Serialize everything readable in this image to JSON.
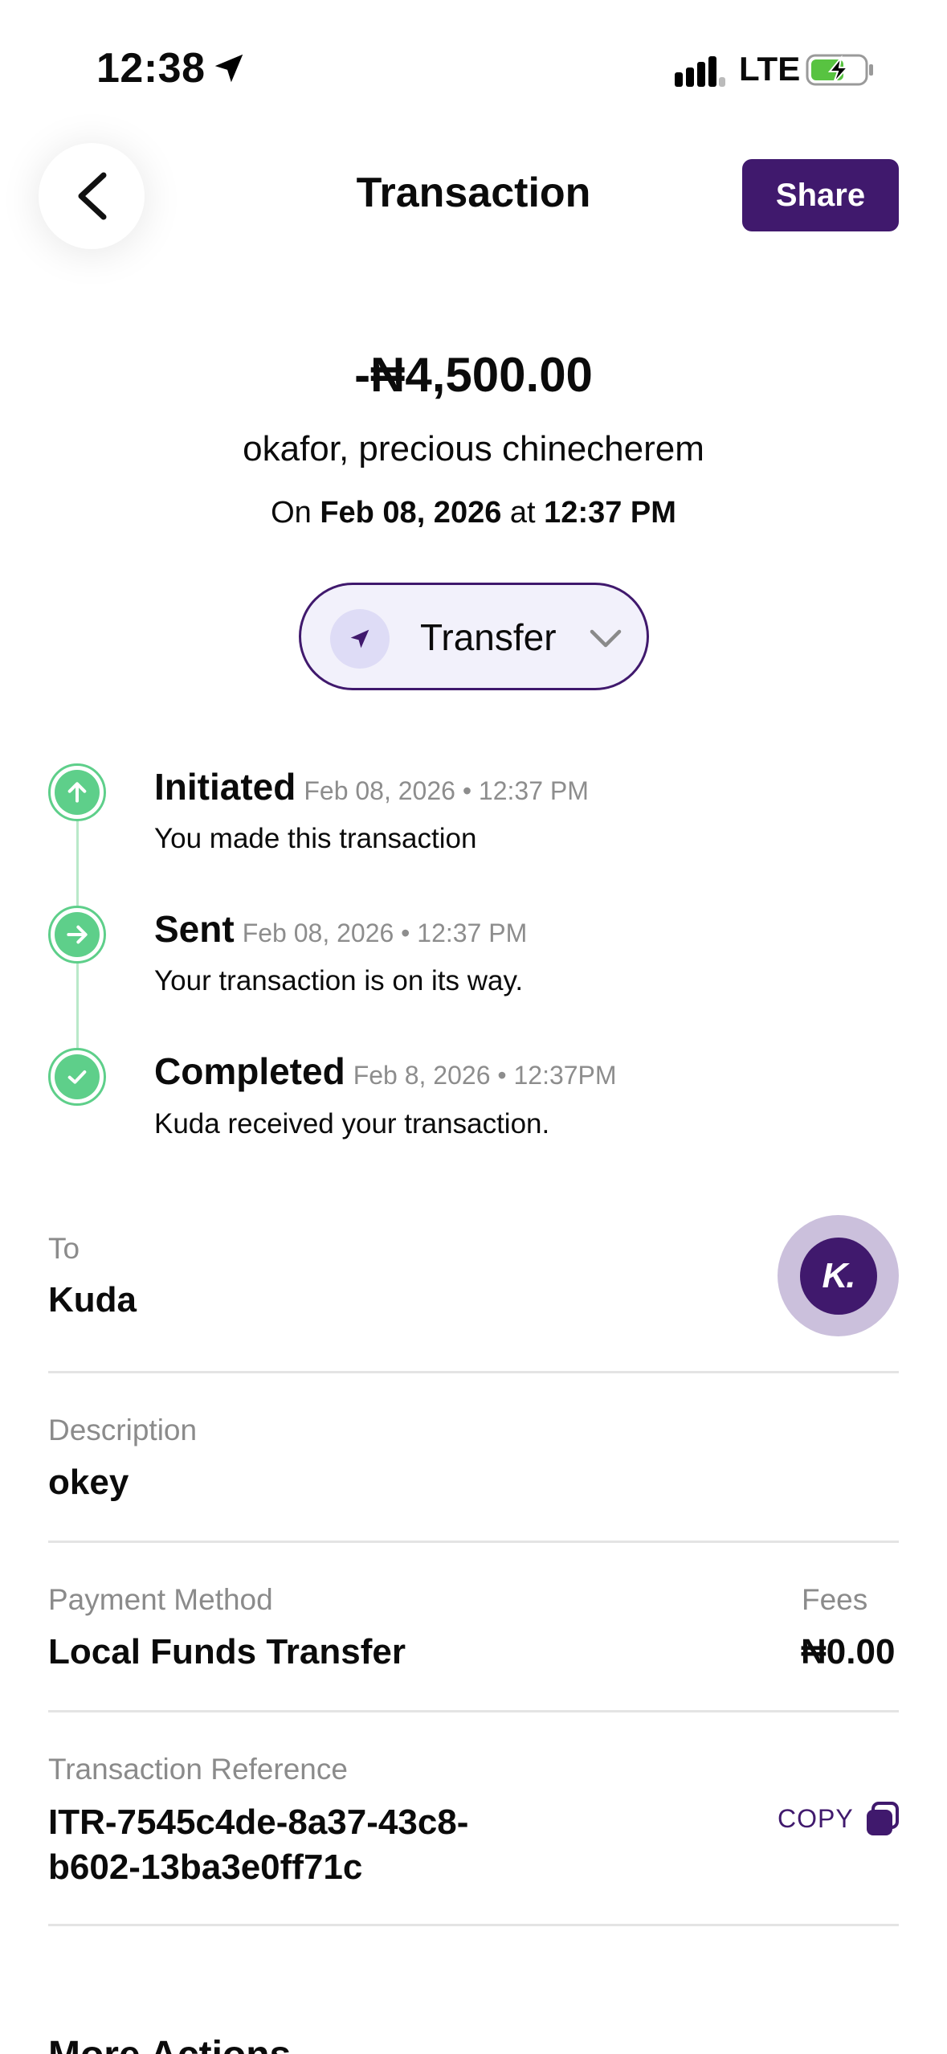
{
  "status_bar": {
    "time": "12:38",
    "network": "LTE"
  },
  "header": {
    "title": "Transaction",
    "share_label": "Share"
  },
  "summary": {
    "amount": "-₦4,500.00",
    "recipient": "okafor, precious chinecherem",
    "date_prefix": "On ",
    "date": "Feb 08, 2026",
    "date_mid": " at ",
    "time": "12:37 PM"
  },
  "type_pill": {
    "label": "Transfer"
  },
  "timeline": [
    {
      "title": "Initiated",
      "time": "Feb 08, 2026 • 12:37 PM",
      "desc": "You made this transaction"
    },
    {
      "title": "Sent",
      "time": "Feb 08, 2026 • 12:37 PM",
      "desc": "Your transaction is on its way."
    },
    {
      "title": "Completed",
      "time": "Feb 8, 2026 • 12:37PM",
      "desc": "Kuda received your transaction."
    }
  ],
  "details": {
    "to_label": "To",
    "to_value": "Kuda",
    "logo_text": "K.",
    "description_label": "Description",
    "description_value": "okey",
    "payment_method_label": "Payment Method",
    "payment_method_value": "Local Funds Transfer",
    "fees_label": "Fees",
    "fees_value": "₦0.00",
    "reference_label": "Transaction Reference",
    "reference_line1": "ITR-7545c4de-8a37-43c8-",
    "reference_line2": "b602-13ba3e0ff71c",
    "copy_label": "COPY"
  },
  "more_actions": {
    "title": "More Actions"
  },
  "colors": {
    "brand": "#40196d",
    "success": "#5ecf8a",
    "muted": "#8b8b8b"
  }
}
